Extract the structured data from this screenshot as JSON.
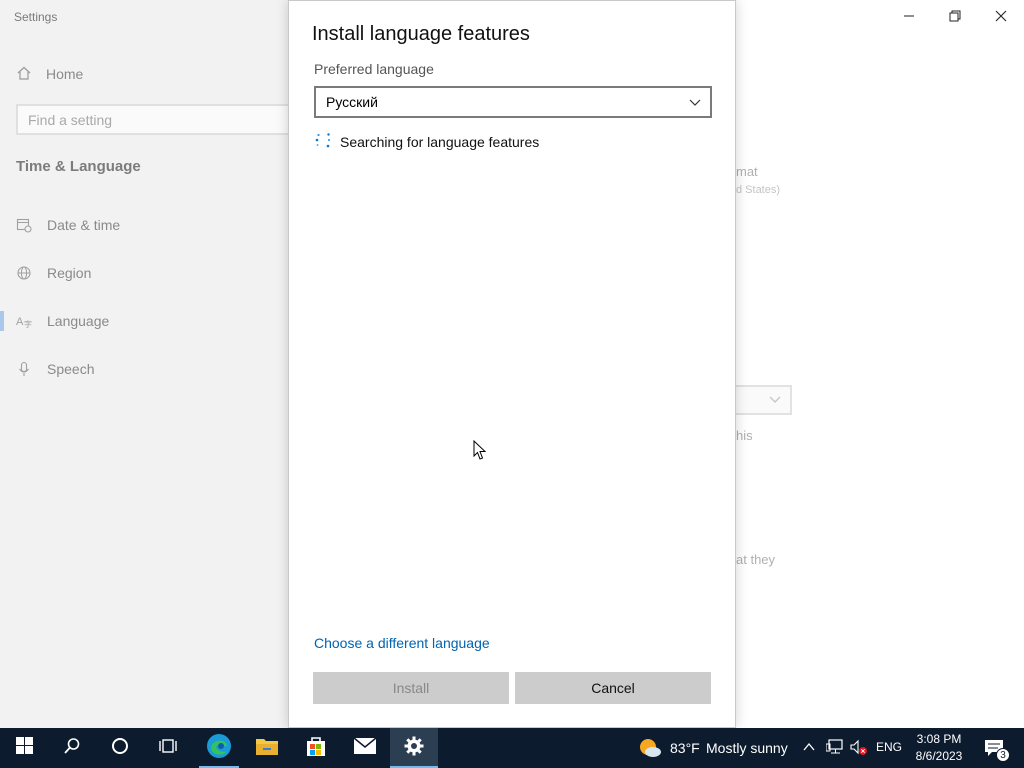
{
  "settings": {
    "app_title": "Settings",
    "home_label": "Home",
    "search_placeholder": "Find a setting",
    "section_title": "Time & Language",
    "nav_items": [
      {
        "label": "Date & time",
        "icon": "calendar-clock-icon"
      },
      {
        "label": "Region",
        "icon": "globe-icon"
      },
      {
        "label": "Language",
        "icon": "language-icon",
        "active": true
      },
      {
        "label": "Speech",
        "icon": "microphone-icon"
      }
    ],
    "fragments": {
      "format": "mat",
      "format_sub": "d States)",
      "this": "his",
      "that_they": "at they"
    }
  },
  "dialog": {
    "title": "Install language features",
    "preferred_label": "Preferred language",
    "selected_language": "Русский",
    "searching_text": "Searching for language features",
    "choose_link": "Choose a different language",
    "install_label": "Install",
    "cancel_label": "Cancel"
  },
  "taskbar": {
    "weather": {
      "temperature": "83°F",
      "condition": "Mostly sunny"
    },
    "language": "ENG",
    "time": "3:08 PM",
    "date": "8/6/2023",
    "notification_count": "3"
  },
  "colors": {
    "accent": "#0063b1",
    "taskbar": "#0c1b2d",
    "taskbar_highlight": "#76b9ed"
  }
}
